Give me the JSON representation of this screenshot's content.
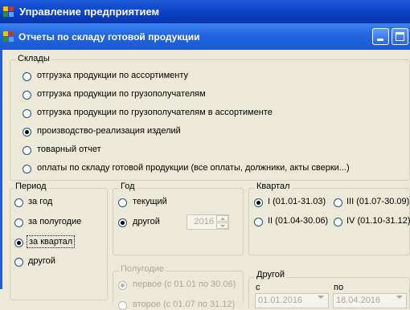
{
  "app": {
    "title": "Управление предприятием"
  },
  "window": {
    "title": "Отчеты по складу готовой продукции"
  },
  "warehouses": {
    "label": "Склады",
    "options": [
      {
        "label": "отгрузка продукции по ассортименту",
        "selected": false
      },
      {
        "label": "отгрузка продукции по грузополучателям",
        "selected": false
      },
      {
        "label": "отгрузка продукции по грузополучателям в ассортименте",
        "selected": false
      },
      {
        "label": "производство-реализация изделий",
        "selected": true
      },
      {
        "label": "товарный отчет",
        "selected": false
      },
      {
        "label": "оплаты по складу готовой продукции (все оплаты, должники, акты сверки...)",
        "selected": false
      }
    ]
  },
  "period": {
    "label": "Период",
    "options": [
      {
        "label": "за год",
        "selected": false
      },
      {
        "label": "за полугодие",
        "selected": false
      },
      {
        "label": "за квартал",
        "selected": true
      },
      {
        "label": "другой",
        "selected": false
      }
    ]
  },
  "year": {
    "label": "Год",
    "current_label": "текущий",
    "other_label": "другой",
    "selected": "другой",
    "value": "2016"
  },
  "quarter": {
    "label": "Квартал",
    "q1": "I  (01.01-31.03)",
    "q2": "II (01.04-30.06)",
    "q3": "III (01.07-30.09)",
    "q4": "IV (01.10-31.12)",
    "selected": "I"
  },
  "halfyear": {
    "label": "Полугодие",
    "first": "первое (с 01.01 по 30.06)",
    "second": "второе (с 01.07 по 31.12)",
    "selected": "первое",
    "enabled": false
  },
  "other": {
    "label": "Другой",
    "from_label": "с",
    "to_label": "по",
    "from_value": "01.01.2016",
    "to_value": "18.04.2016"
  }
}
